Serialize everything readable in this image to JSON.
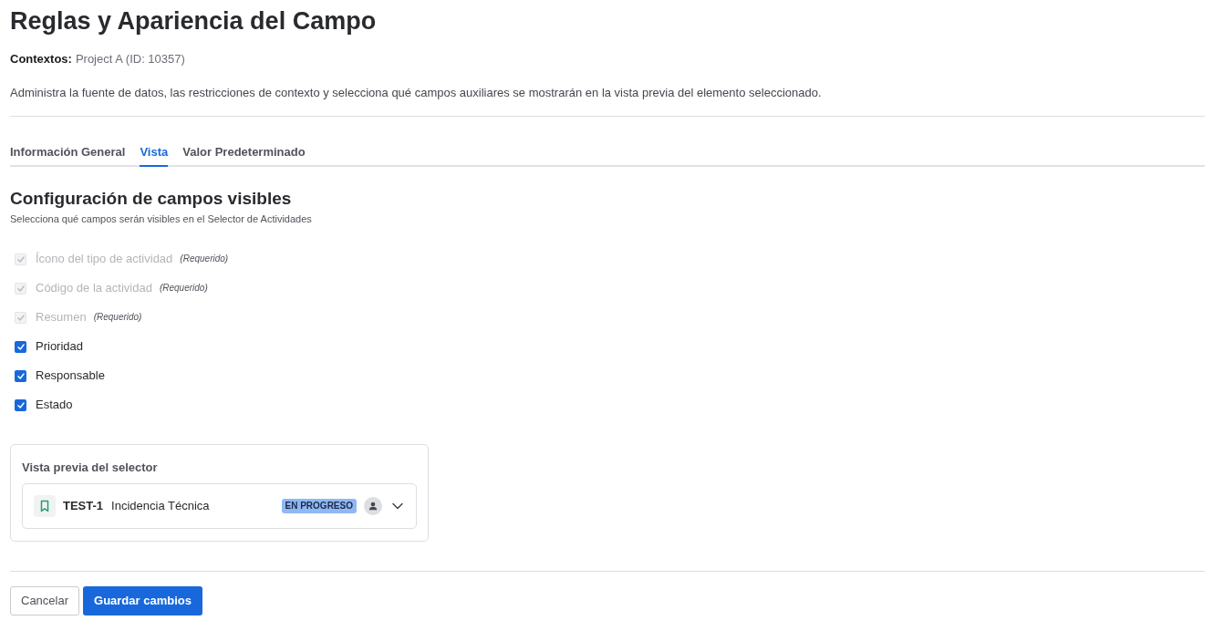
{
  "page": {
    "title": "Reglas y Apariencia del Campo",
    "context_label": "Contextos:",
    "context_value": "Project A (ID: 10357)",
    "description": "Administra la fuente de datos, las restricciones de contexto y selecciona qué campos auxiliares se mostrarán en la vista previa del elemento seleccionado."
  },
  "tabs": [
    {
      "label": "Información General",
      "selected": false
    },
    {
      "label": "Vista",
      "selected": true
    },
    {
      "label": "Valor Predeterminado",
      "selected": false
    }
  ],
  "section": {
    "title": "Configuración de campos visibles",
    "subtitle": "Selecciona qué campos serán visibles en el Selector de Actividades"
  },
  "fields": [
    {
      "label": "Ícono del tipo de actividad",
      "note": "(Requerido)",
      "checked": true,
      "disabled": true
    },
    {
      "label": "Código de la actividad",
      "note": "(Requerido)",
      "checked": true,
      "disabled": true
    },
    {
      "label": "Resumen",
      "note": "(Requerido)",
      "checked": true,
      "disabled": true
    },
    {
      "label": "Prioridad",
      "checked": true,
      "disabled": false
    },
    {
      "label": "Responsable",
      "checked": true,
      "disabled": false
    },
    {
      "label": "Estado",
      "checked": true,
      "disabled": false
    }
  ],
  "preview": {
    "title": "Vista previa del selector",
    "item": {
      "key": "TEST-1",
      "summary": "Incidencia Técnica",
      "status": "EN PROGRESO"
    }
  },
  "buttons": [
    {
      "label": "Cancelar",
      "kind": "secondary"
    },
    {
      "label": "Guardar cambios",
      "kind": "primary"
    }
  ]
}
